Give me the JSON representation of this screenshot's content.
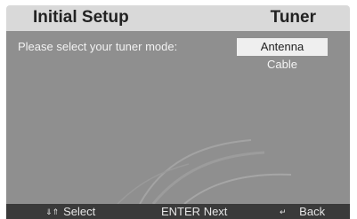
{
  "header": {
    "title": "Initial Setup",
    "section": "Tuner"
  },
  "prompt": "Please select your tuner mode:",
  "options": [
    {
      "label": "Antenna",
      "selected": true
    },
    {
      "label": "Cable",
      "selected": false
    }
  ],
  "footer": {
    "select": {
      "icon": "up-down-arrows-icon",
      "glyph": "⇓⇑",
      "label": "Select"
    },
    "next": {
      "key": "ENTER",
      "label": "Next"
    },
    "back": {
      "icon": "back-arrow-icon",
      "glyph": "↵",
      "label": "Back"
    }
  },
  "colors": {
    "header": "#d9d9d9",
    "panel": "#8f8f8f",
    "footer": "#3a3a3a",
    "selected": "#efefef"
  }
}
